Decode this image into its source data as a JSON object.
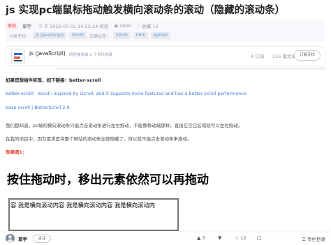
{
  "article": {
    "title": "js 实现pc端鼠标拖动触发横向滚动条的滚动（隐藏的滚动条）"
  },
  "meta": {
    "badge": "原创",
    "author": "草宇",
    "date": "于 2022-07-01 14:12:24 修改",
    "views": "2846",
    "favorites": "收藏 12",
    "column_label": "分类专栏：",
    "column_tags": [
      "js (JavaScript)",
      "html5"
    ],
    "article_tags_label": "文章标签：",
    "article_tags": [
      "html5",
      "html",
      "python"
    ],
    "edit_link": ""
  },
  "column_card": {
    "name": "js (JavaScript)",
    "subtitle": "同时被收录 2 个专栏收录",
    "articles": "4 订阅",
    "subscribers": "216 篇文章",
    "subscribe_label": "订阅专栏"
  },
  "content": {
    "intro": "如果您想插件实现，如下链接：better-scroll",
    "link1": "better-scroll：iscroll: inspired by iscroll, and it supports more features and has a better scroll performance",
    "link2": "base-scroll | BetterScroll 2.0",
    "para1": "我们都知道，pc端的横向滚动条只能点击滚动条进行左右拖动，不能像移动端那样，直接在空白区域就可以左右拖动。",
    "para2": "在我的项目中，因为需求是将整个网站的滚动条全部隐藏了，所以就不能点击滚动条来拖动。",
    "effect_label": "效果图1："
  },
  "demo": {
    "heading": "按住拖动时，移出元素依然可以再拖动",
    "scroll_text": "容 我是横向滚动内容 我是横向滚动内容 我是横向滚动内"
  },
  "bottom_bar": {
    "author": "草宇",
    "follow_label": "关注",
    "likes": "3",
    "dislike": "",
    "favorites": "12",
    "comments": "",
    "column_label": "专栏目录"
  },
  "icons": {
    "views": "eye-icon",
    "favorites": "star-icon",
    "like": "thumbs-up-icon",
    "dislike": "thumbs-down-icon",
    "comment": "comment-icon",
    "column": "list-icon"
  },
  "colors": {
    "accent_red": "#e33e33",
    "link_blue": "#3c78d8",
    "tag_blue": "#5094d5"
  }
}
